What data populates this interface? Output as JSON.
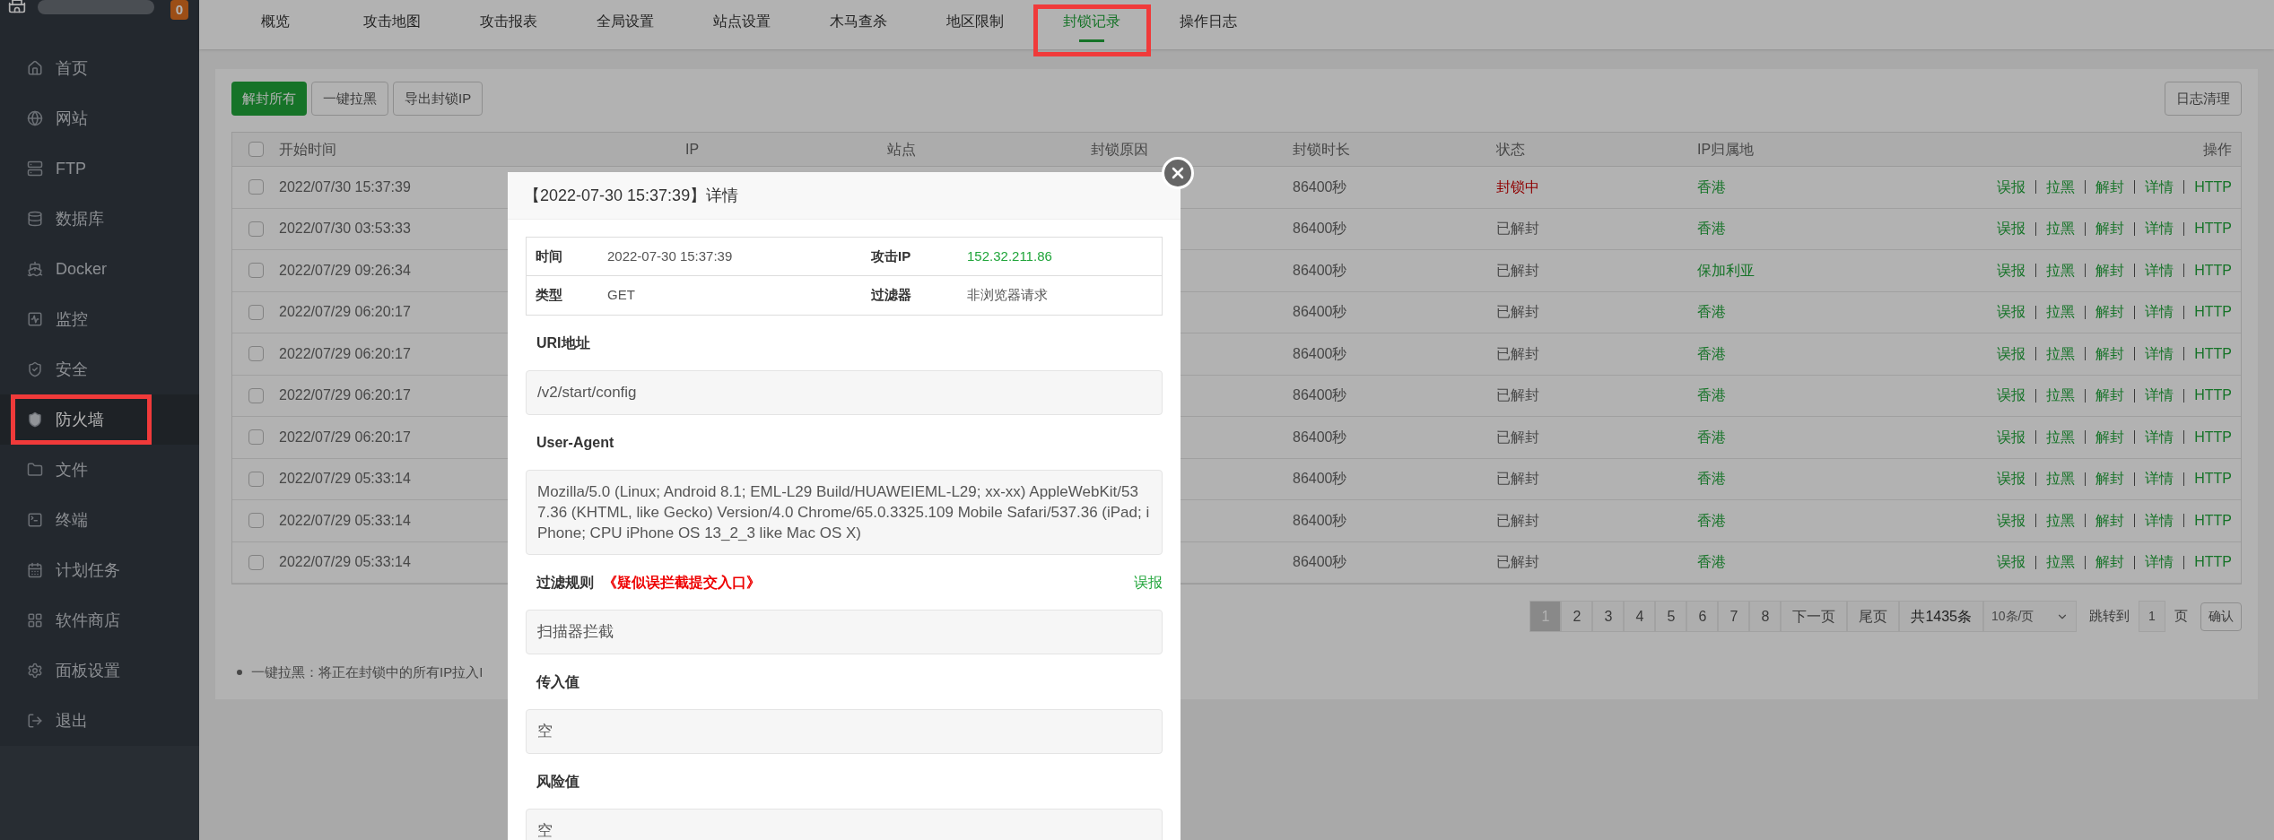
{
  "sidebar": {
    "badge": "0",
    "items": [
      {
        "label": "首页",
        "selected": false,
        "highlighted": false
      },
      {
        "label": "网站",
        "selected": false,
        "highlighted": false
      },
      {
        "label": "FTP",
        "selected": false,
        "highlighted": false
      },
      {
        "label": "数据库",
        "selected": false,
        "highlighted": false
      },
      {
        "label": "Docker",
        "selected": false,
        "highlighted": false
      },
      {
        "label": "监控",
        "selected": false,
        "highlighted": false
      },
      {
        "label": "安全",
        "selected": false,
        "highlighted": false
      },
      {
        "label": "防火墙",
        "selected": true,
        "highlighted": true
      },
      {
        "label": "文件",
        "selected": false,
        "highlighted": false
      },
      {
        "label": "终端",
        "selected": false,
        "highlighted": false
      },
      {
        "label": "计划任务",
        "selected": false,
        "highlighted": false
      },
      {
        "label": "软件商店",
        "selected": false,
        "highlighted": false
      },
      {
        "label": "面板设置",
        "selected": false,
        "highlighted": false
      },
      {
        "label": "退出",
        "selected": false,
        "highlighted": false
      }
    ]
  },
  "tabs": [
    {
      "label": "概览",
      "selected": false,
      "highlighted": false
    },
    {
      "label": "攻击地图",
      "selected": false,
      "highlighted": false
    },
    {
      "label": "攻击报表",
      "selected": false,
      "highlighted": false
    },
    {
      "label": "全局设置",
      "selected": false,
      "highlighted": false
    },
    {
      "label": "站点设置",
      "selected": false,
      "highlighted": false
    },
    {
      "label": "木马查杀",
      "selected": false,
      "highlighted": false
    },
    {
      "label": "地区限制",
      "selected": false,
      "highlighted": false
    },
    {
      "label": "封锁记录",
      "selected": true,
      "highlighted": true
    },
    {
      "label": "操作日志",
      "selected": false,
      "highlighted": false
    }
  ],
  "toolbar": {
    "buttons": [
      {
        "label": "解封所有",
        "kind": "primary"
      },
      {
        "label": "一键拉黑",
        "kind": "default"
      },
      {
        "label": "导出封锁IP",
        "kind": "default"
      }
    ],
    "clean_button": "日志清理"
  },
  "table": {
    "select_all_checked": false,
    "columns": [
      "开始时间",
      "IP",
      "站点",
      "封锁原因",
      "封锁时长",
      "状态",
      "IP归属地",
      "操作"
    ],
    "rows": [
      {
        "checked": false,
        "start_time": "2022/07/30 15:37:39",
        "duration": "86400秒",
        "status": "封锁中",
        "blocked": true,
        "location": "香港",
        "actions": [
          "误报",
          "拉黑",
          "解封",
          "详情",
          "HTTP"
        ]
      },
      {
        "checked": false,
        "start_time": "2022/07/30 03:53:33",
        "duration": "86400秒",
        "status": "已解封",
        "blocked": false,
        "location": "香港",
        "actions": [
          "误报",
          "拉黑",
          "解封",
          "详情",
          "HTTP"
        ]
      },
      {
        "checked": false,
        "start_time": "2022/07/29 09:26:34",
        "duration": "86400秒",
        "status": "已解封",
        "blocked": false,
        "location": "保加利亚",
        "actions": [
          "误报",
          "拉黑",
          "解封",
          "详情",
          "HTTP"
        ]
      },
      {
        "checked": false,
        "start_time": "2022/07/29 06:20:17",
        "duration": "86400秒",
        "status": "已解封",
        "blocked": false,
        "location": "香港",
        "actions": [
          "误报",
          "拉黑",
          "解封",
          "详情",
          "HTTP"
        ]
      },
      {
        "checked": false,
        "start_time": "2022/07/29 06:20:17",
        "duration": "86400秒",
        "status": "已解封",
        "blocked": false,
        "location": "香港",
        "actions": [
          "误报",
          "拉黑",
          "解封",
          "详情",
          "HTTP"
        ]
      },
      {
        "checked": false,
        "start_time": "2022/07/29 06:20:17",
        "duration": "86400秒",
        "status": "已解封",
        "blocked": false,
        "location": "香港",
        "actions": [
          "误报",
          "拉黑",
          "解封",
          "详情",
          "HTTP"
        ]
      },
      {
        "checked": false,
        "start_time": "2022/07/29 06:20:17",
        "duration": "86400秒",
        "status": "已解封",
        "blocked": false,
        "location": "香港",
        "actions": [
          "误报",
          "拉黑",
          "解封",
          "详情",
          "HTTP"
        ]
      },
      {
        "checked": false,
        "start_time": "2022/07/29 05:33:14",
        "duration": "86400秒",
        "status": "已解封",
        "blocked": false,
        "location": "香港",
        "actions": [
          "误报",
          "拉黑",
          "解封",
          "详情",
          "HTTP"
        ]
      },
      {
        "checked": false,
        "start_time": "2022/07/29 05:33:14",
        "duration": "86400秒",
        "status": "已解封",
        "blocked": false,
        "location": "香港",
        "actions": [
          "误报",
          "拉黑",
          "解封",
          "详情",
          "HTTP"
        ]
      },
      {
        "checked": false,
        "start_time": "2022/07/29 05:33:14",
        "duration": "86400秒",
        "status": "已解封",
        "blocked": false,
        "location": "香港",
        "actions": [
          "误报",
          "拉黑",
          "解封",
          "详情",
          "HTTP"
        ]
      }
    ]
  },
  "pagination": {
    "pages": [
      {
        "label": "1",
        "selected": true
      },
      {
        "label": "2",
        "selected": false
      },
      {
        "label": "3",
        "selected": false
      },
      {
        "label": "4",
        "selected": false
      },
      {
        "label": "5",
        "selected": false
      },
      {
        "label": "6",
        "selected": false
      },
      {
        "label": "7",
        "selected": false
      },
      {
        "label": "8",
        "selected": false
      }
    ],
    "next": "下一页",
    "last": "尾页",
    "total": "共1435条",
    "page_size": "10条/页",
    "jump_label": "跳转到",
    "jump_value": "1",
    "page_unit": "页",
    "confirm": "确认"
  },
  "note": "一键拉黑：将正在封锁中的所有IP拉入I",
  "modal": {
    "title": "【2022-07-30 15:37:39】详情",
    "info": [
      {
        "label": "时间",
        "value": "2022-07-30 15:37:39",
        "kind": "text"
      },
      {
        "label": "攻击IP",
        "value": "152.32.211.86",
        "kind": "ip"
      },
      {
        "label": "类型",
        "value": "GET",
        "kind": "text"
      },
      {
        "label": "过滤器",
        "value": "非浏览器请求",
        "kind": "text"
      }
    ],
    "sections": [
      {
        "label": "URI地址",
        "value": "/v2/start/config"
      },
      {
        "label": "User-Agent",
        "value": "Mozilla/5.0 (Linux; Android 8.1; EML-L29 Build/HUAWEIEML-L29; xx-xx) AppleWebKit/537.36 (KHTML, like Gecko) Version/4.0 Chrome/65.0.3325.109 Mobile Safari/537.36 (iPad; iPhone; CPU iPhone OS 13_2_3 like Mac OS X)"
      },
      {
        "label": "过滤规则",
        "link": "《疑似误拦截提交入口》",
        "action": "误报",
        "value": "扫描器拦截"
      },
      {
        "label": "传入值",
        "value": "空"
      },
      {
        "label": "风险值",
        "value": "空"
      }
    ]
  }
}
